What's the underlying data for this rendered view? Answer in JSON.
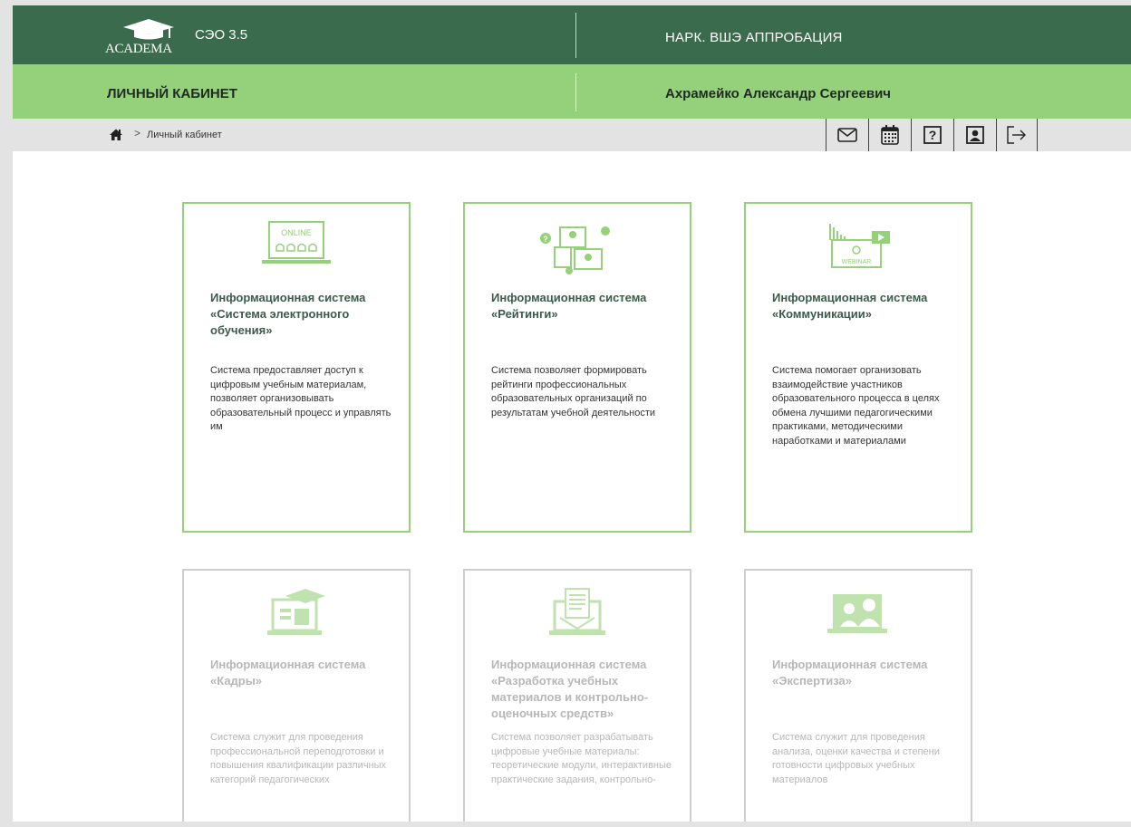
{
  "header": {
    "logo_text": "ACADEMA",
    "app_name": "СЭО 3.5",
    "org_name": "НАРК. ВШЭ АППРОБАЦИЯ"
  },
  "subheader": {
    "section_title": "ЛИЧНЫЙ КАБИНЕТ",
    "user_name": "Ахрамейко Александр Сергеевич"
  },
  "breadcrumb": {
    "separator": ">",
    "current": "Личный кабинет"
  },
  "toolbar": {
    "icons": [
      "mail-icon",
      "calendar-icon",
      "help-icon",
      "profile-icon",
      "logout-icon"
    ]
  },
  "colors": {
    "header_dark": "#3a6b4d",
    "header_light": "#95d07a",
    "card_active_border": "#95d07a",
    "card_inactive_border": "#cfcfcf"
  },
  "cards": [
    {
      "icon": "online-learning-icon",
      "title": "Информационная система «Система электронного обучения»",
      "desc": "Система предоставляет доступ к цифровым учебным материалам, позволяет организовывать образовательный процесс и управлять им",
      "active": true
    },
    {
      "icon": "ratings-icon",
      "title": "Информационная система «Рейтинги»",
      "desc": "Система позволяет формировать рейтинги профессиональных образовательных организаций по результатам учебной деятельности",
      "active": true
    },
    {
      "icon": "webinar-icon",
      "title": "Информационная система «Коммуникации»",
      "desc": "Система помогает организовать взаимодействие участников образовательного процесса в целях обмена лучшими педагогическими практиками, методическими наработками и материалами",
      "active": true
    },
    {
      "icon": "personnel-icon",
      "title": "Информационная система «Кадры»",
      "desc": "Система служит для проведения профессиональной переподготовки и повышения квалификации различных категорий педагогических",
      "active": false
    },
    {
      "icon": "materials-development-icon",
      "title": "Информационная система «Разработка учебных материалов и контрольно-оценочных средств»",
      "desc": "Система позволяет разрабатывать цифровые учебные материалы: теоретические модули, интерактивные практические задания, контрольно-",
      "active": false
    },
    {
      "icon": "expertise-icon",
      "title": "Информационная система «Экспертиза»",
      "desc": "Система служит для проведения анализа, оценки качества и степени готовности цифровых учебных материалов",
      "active": false
    }
  ]
}
